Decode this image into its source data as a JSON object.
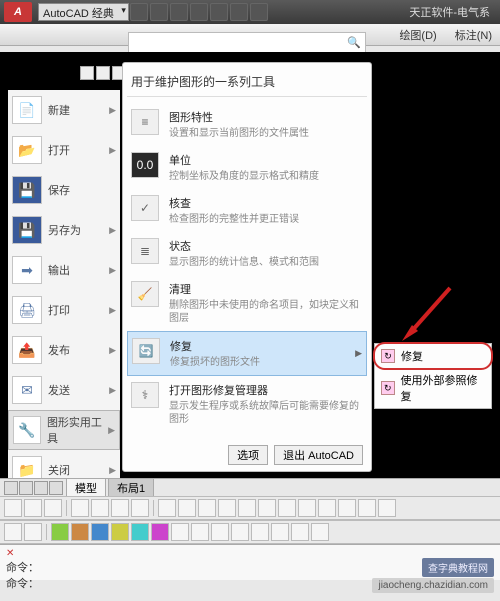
{
  "titlebar": {
    "app": "A",
    "workspace": "AutoCAD 经典",
    "title": "天正软件-电气系"
  },
  "menubar": {
    "draw": "绘图(D)",
    "annot": "标注(N)"
  },
  "search": {
    "placeholder": ""
  },
  "leftmenu": {
    "items": [
      {
        "label": "新建",
        "arrow": true
      },
      {
        "label": "打开",
        "arrow": true
      },
      {
        "label": "保存",
        "arrow": false
      },
      {
        "label": "另存为",
        "arrow": true
      },
      {
        "label": "输出",
        "arrow": true
      },
      {
        "label": "打印",
        "arrow": true
      },
      {
        "label": "发布",
        "arrow": true
      },
      {
        "label": "发送",
        "arrow": true
      },
      {
        "label": "图形实用工具",
        "arrow": true
      },
      {
        "label": "关闭",
        "arrow": true
      }
    ]
  },
  "panel": {
    "title": "用于维护图形的一系列工具",
    "items": [
      {
        "hd": "图形特性",
        "sub": "设置和显示当前图形的文件属性"
      },
      {
        "hd": "单位",
        "sub": "控制坐标及角度的显示格式和精度"
      },
      {
        "hd": "核查",
        "sub": "检查图形的完整性并更正错误"
      },
      {
        "hd": "状态",
        "sub": "显示图形的统计信息、模式和范围"
      },
      {
        "hd": "清理",
        "sub": "删除图形中未使用的命名项目，如块定义和图层"
      },
      {
        "hd": "修复",
        "sub": "修复损坏的图形文件"
      },
      {
        "hd": "打开图形修复管理器",
        "sub": "显示发生程序或系统故障后可能需要修复的图形"
      }
    ],
    "btns": {
      "opt": "选项",
      "exit": "退出 AutoCAD"
    }
  },
  "flyout": {
    "i1": "修复",
    "i2": "使用外部参照修复"
  },
  "tabs": {
    "t1": "模型",
    "t2": "布局1"
  },
  "cmd": {
    "l1": "命令：",
    "l2": "命令："
  },
  "watermark": {
    "w1": "查字典教程网",
    "w2": "jiaocheng.chazidian.com"
  }
}
